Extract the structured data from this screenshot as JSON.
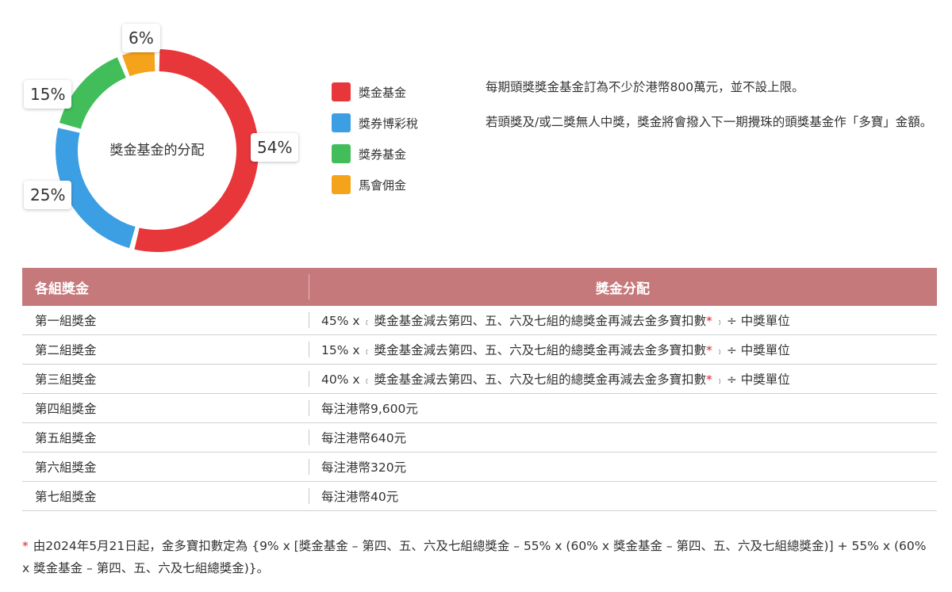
{
  "chart_data": {
    "type": "pie",
    "title": "獎金基金的分配",
    "categories": [
      "獎金基金",
      "獎券博彩稅",
      "獎券基金",
      "馬會佣金"
    ],
    "values": [
      54,
      25,
      15,
      6
    ],
    "value_labels": [
      "54%",
      "25%",
      "15%",
      "6%"
    ],
    "colors": [
      "#e8373b",
      "#3d9fe3",
      "#41be5a",
      "#f5a31a"
    ],
    "legend_position": "right"
  },
  "info": {
    "paragraph1": "每期頭獎獎金基金訂為不少於港幣800萬元，並不設上限。",
    "paragraph2": "若頭獎及/或二獎無人中獎，獎金將會撥入下一期攪珠的頭獎基金作「多寶」金額。"
  },
  "table": {
    "headers": {
      "group": "各組獎金",
      "allocation": "獎金分配"
    },
    "rows": [
      {
        "group": "第一組獎金",
        "prefix": "45% x",
        "open_bracket": "﹝",
        "body": "獎金基金減去第四、五、六及七組的總獎金再減去金多寶扣數",
        "asterisk": "*",
        "close_bracket": "﹞",
        "suffix": "÷ 中獎單位"
      },
      {
        "group": "第二組獎金",
        "prefix": "15% x",
        "open_bracket": "﹝",
        "body": "獎金基金減去第四、五、六及七組的總獎金再減去金多寶扣數",
        "asterisk": "*",
        "close_bracket": "﹞",
        "suffix": "÷ 中獎單位"
      },
      {
        "group": "第三組獎金",
        "prefix": "40% x",
        "open_bracket": "﹝",
        "body": "獎金基金減去第四、五、六及七組的總獎金再減去金多寶扣數",
        "asterisk": "*",
        "close_bracket": "﹞",
        "suffix": "÷ 中獎單位"
      },
      {
        "group": "第四組獎金",
        "text": "每注港幣9,600元"
      },
      {
        "group": "第五組獎金",
        "text": "每注港幣640元"
      },
      {
        "group": "第六組獎金",
        "text": "每注港幣320元"
      },
      {
        "group": "第七組獎金",
        "text": "每注港幣40元"
      }
    ]
  },
  "footnote": {
    "asterisk": "*",
    "text": "由2024年5月21日起，金多寶扣數定為 {9% x [獎金基金 – 第四、五、六及七組總獎金 – 55% x (60% x 獎金基金 – 第四、五、六及七組總獎金)] + 55% x (60% x 獎金基金 – 第四、五、六及七組總獎金)}。"
  }
}
